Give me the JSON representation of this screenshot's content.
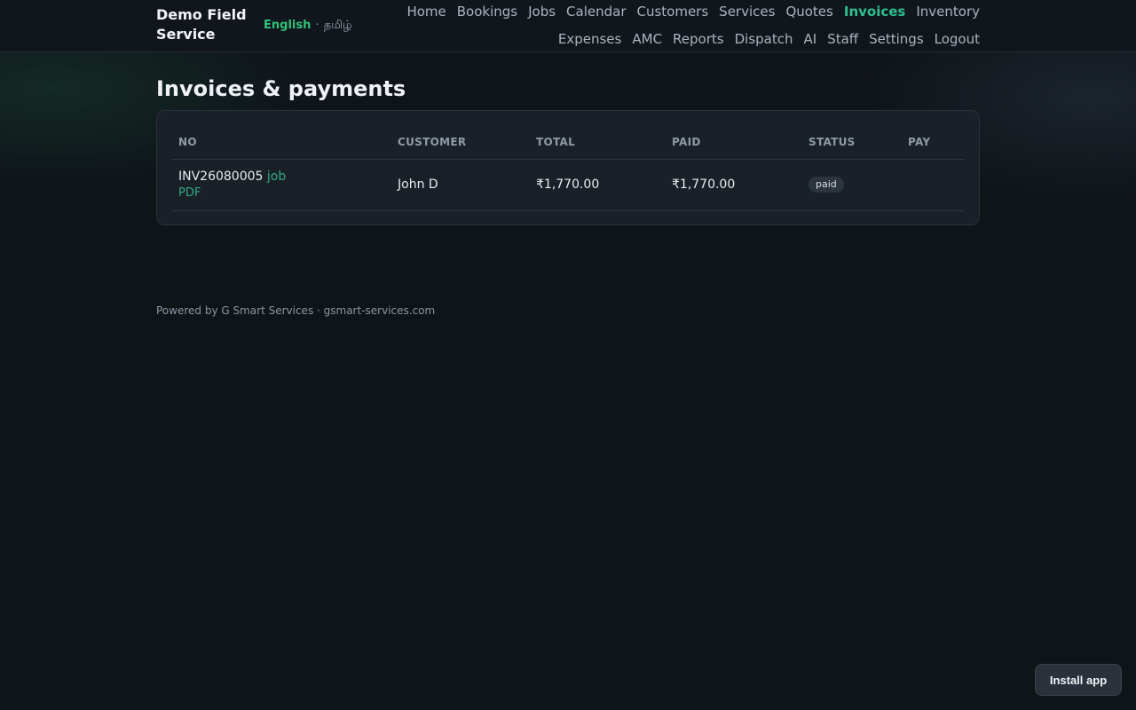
{
  "brand": {
    "name": "Demo Field Service"
  },
  "language": {
    "active": "English",
    "separator": "·",
    "other": "தமிழ்"
  },
  "nav": {
    "items": [
      {
        "label": "Home"
      },
      {
        "label": "Bookings"
      },
      {
        "label": "Jobs"
      },
      {
        "label": "Calendar"
      },
      {
        "label": "Customers"
      },
      {
        "label": "Services"
      },
      {
        "label": "Quotes"
      },
      {
        "label": "Invoices",
        "active": true
      },
      {
        "label": "Inventory"
      },
      {
        "label": "Expenses"
      },
      {
        "label": "AMC"
      },
      {
        "label": "Reports"
      },
      {
        "label": "Dispatch"
      },
      {
        "label": "AI"
      },
      {
        "label": "Staff"
      },
      {
        "label": "Settings"
      },
      {
        "label": "Logout"
      }
    ]
  },
  "page": {
    "title": "Invoices & payments"
  },
  "table": {
    "columns": [
      "NO",
      "CUSTOMER",
      "TOTAL",
      "PAID",
      "STATUS",
      "PAY"
    ],
    "rows": [
      {
        "no": "INV26080005",
        "job_link": "job",
        "pdf_link": "PDF",
        "customer": "John D",
        "total": "₹1,770.00",
        "paid": "₹1,770.00",
        "status": "paid",
        "pay": ""
      }
    ]
  },
  "footer": {
    "text": "Powered by G Smart Services · gsmart-services.com"
  },
  "install": {
    "label": "Install app"
  },
  "colors": {
    "accent": "#2fbf8f",
    "lang_active": "#34c27a",
    "background": "#0f1419"
  }
}
